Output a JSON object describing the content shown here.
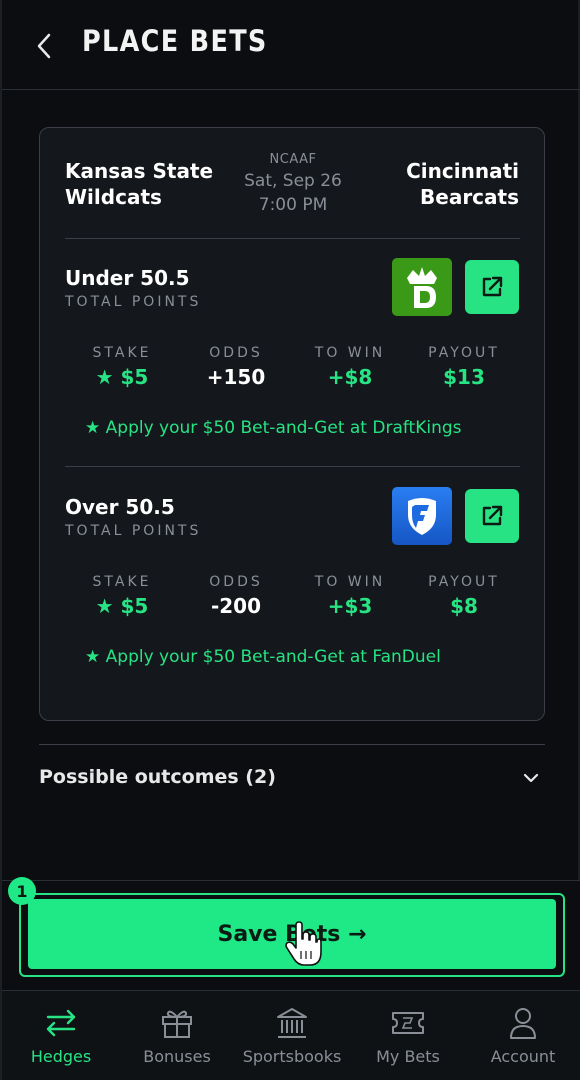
{
  "header": {
    "title": "PLACE BETS"
  },
  "game": {
    "home_team_line1": "Kansas State",
    "home_team_line2": "Wildcats",
    "away_team_line1": "Cincinnati",
    "away_team_line2": "Bearcats",
    "league": "NCAAF",
    "date": "Sat, Sep 26",
    "time": "7:00 PM"
  },
  "bets": [
    {
      "line": "Under 50.5",
      "type": "TOTAL POINTS",
      "sportsbook_icon": "draftkings-logo",
      "sportsbook_color": "#3a9a17",
      "stake_label": "STAKE",
      "stake_value": "★ $5",
      "odds_label": "ODDS",
      "odds_value": "+150",
      "towin_label": "TO WIN",
      "towin_value": "+$8",
      "payout_label": "PAYOUT",
      "payout_value": "$13",
      "promo": "★  Apply your $50 Bet-and-Get at DraftKings"
    },
    {
      "line": "Over 50.5",
      "type": "TOTAL POINTS",
      "sportsbook_icon": "fanduel-logo",
      "sportsbook_color": "#1e6ae0",
      "stake_label": "STAKE",
      "stake_value": "★ $5",
      "odds_label": "ODDS",
      "odds_value": "-200",
      "towin_label": "TO WIN",
      "towin_value": "+$3",
      "payout_label": "PAYOUT",
      "payout_value": "$8",
      "promo": "★  Apply your $50 Bet-and-Get at FanDuel"
    }
  ],
  "outcomes": {
    "label": "Possible outcomes (2)"
  },
  "save": {
    "label": "Save Bets  →",
    "step_badge": "1"
  },
  "nav": {
    "items": [
      {
        "label": "Hedges",
        "icon": "arrows-swap-icon",
        "active": true
      },
      {
        "label": "Bonuses",
        "icon": "gift-icon",
        "active": false
      },
      {
        "label": "Sportsbooks",
        "icon": "bank-icon",
        "active": false
      },
      {
        "label": "My Bets",
        "icon": "ticket-icon",
        "active": false
      },
      {
        "label": "Account",
        "icon": "person-icon",
        "active": false
      }
    ]
  },
  "colors": {
    "accent": "#27e384",
    "background": "#0b0d10",
    "card": "#14171b",
    "muted": "#8a8f97"
  }
}
